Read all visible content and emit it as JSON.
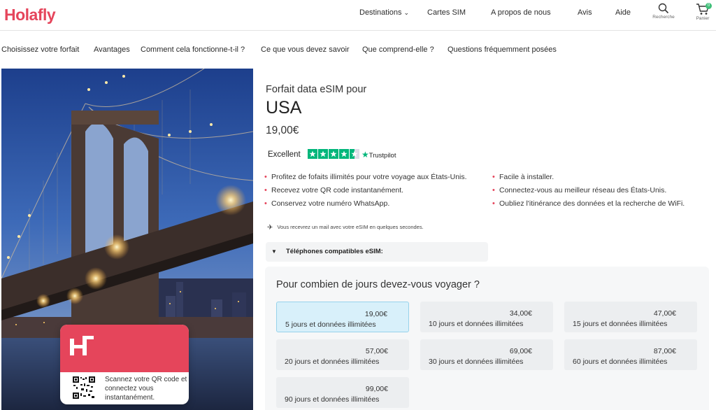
{
  "header": {
    "logo": "Holafly",
    "nav": [
      "Destinations",
      "Cartes SIM",
      "A propos de nous",
      "Avis",
      "Aide"
    ],
    "search_label": "Recherche",
    "cart_label": "Panier",
    "cart_count": "0"
  },
  "subnav": [
    "Choisissez votre forfait",
    "Avantages",
    "Comment cela fonctionne-t-il ?",
    "Ce que vous devez savoir",
    "Que comprend-elle ?",
    "Questions fréquemment posées"
  ],
  "hero": {
    "qr_text": "Scannez votre QR code et connectez vous instantanément."
  },
  "product": {
    "subtitle": "Forfait data eSIM pour",
    "title": "USA",
    "price": "19,00€",
    "trustpilot": {
      "label": "Excellent",
      "brand": "Trustpilot",
      "stars": 4.5
    },
    "bullets_left": [
      "Profitez de fofaits illimités pour votre voyage aux États-Unis.",
      "Recevez votre QR code instantanément.",
      "Conservez votre numéro WhatsApp."
    ],
    "bullets_right": [
      "Facile à installer.",
      "Connectez-vous au meilleur réseau des États-Unis.",
      "Oubliez l'itinérance des données et la recherche de WiFi."
    ],
    "mail_note": "Vous recevrez un mail avec votre eSIM en quelques secondes.",
    "compat_label": "Téléphones compatibles eSIM:"
  },
  "days": {
    "title": "Pour combien de jours devez-vous voyager ?",
    "options": [
      {
        "price": "19,00€",
        "name": "5 jours et données illimitées",
        "selected": true
      },
      {
        "price": "34,00€",
        "name": "10 jours et données illimitées",
        "selected": false
      },
      {
        "price": "47,00€",
        "name": "15 jours et données illimitées",
        "selected": false
      },
      {
        "price": "57,00€",
        "name": "20 jours et données illimitées",
        "selected": false
      },
      {
        "price": "69,00€",
        "name": "30 jours et données illimitées",
        "selected": false
      },
      {
        "price": "87,00€",
        "name": "60 jours et données illimitées",
        "selected": false
      },
      {
        "price": "99,00€",
        "name": "90 jours et données illimitées",
        "selected": false
      }
    ]
  },
  "colors": {
    "brand": "#e5455b",
    "trustpilot": "#00b67a",
    "selected_bg": "#d8f0fa"
  }
}
